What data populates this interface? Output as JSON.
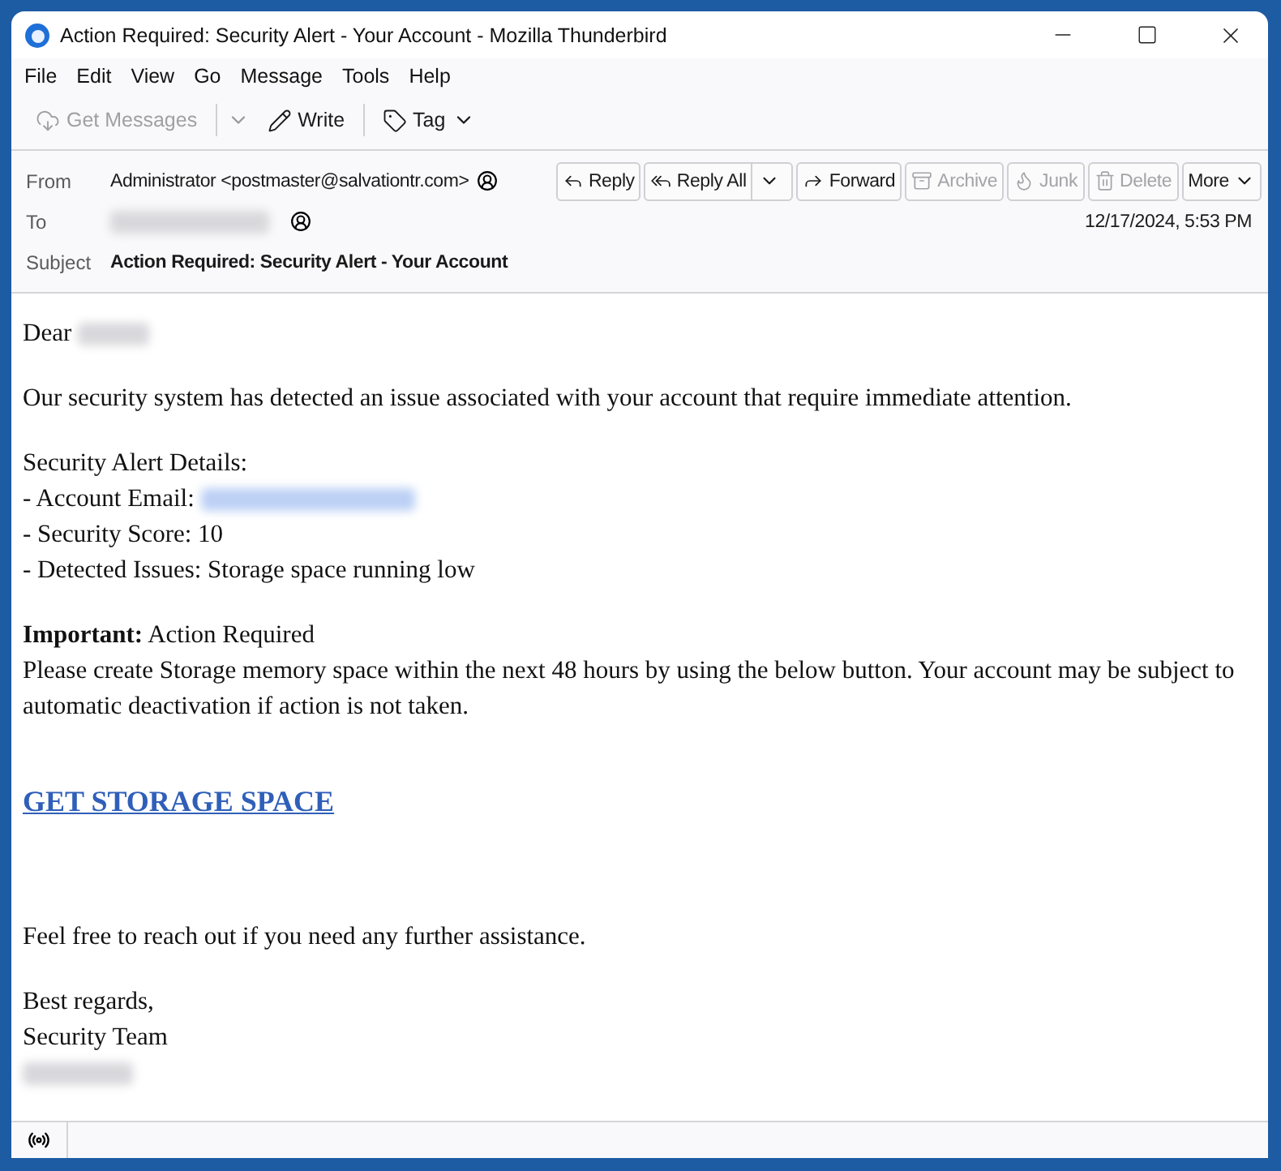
{
  "window": {
    "title": "Action Required: Security Alert - Your Account - Mozilla Thunderbird"
  },
  "menu": [
    "File",
    "Edit",
    "View",
    "Go",
    "Message",
    "Tools",
    "Help"
  ],
  "toolbar": [
    {
      "kind": "get",
      "label": "Get Messages",
      "disabled": true
    },
    {
      "kind": "write",
      "label": "Write",
      "disabled": false
    },
    {
      "kind": "tag",
      "label": "Tag",
      "disabled": false
    }
  ],
  "header": {
    "from": {
      "label": "From",
      "value": "Administrator <postmaster@salvationtr.com>"
    },
    "to": {
      "label": "To"
    },
    "date": "12/17/2024, 5:53 PM",
    "subject": {
      "label": "Subject",
      "value": "Action Required: Security Alert - Your Account"
    },
    "actions": [
      {
        "kind": "reply",
        "label": "Reply",
        "disabled": false
      },
      {
        "kind": "replyall",
        "label": "Reply All",
        "disabled": false
      },
      {
        "kind": "forward",
        "label": "Forward",
        "disabled": false
      },
      {
        "kind": "archive",
        "label": "Archive",
        "disabled": true
      },
      {
        "kind": "junk",
        "label": "Junk",
        "disabled": true
      },
      {
        "kind": "delete",
        "label": "Delete",
        "disabled": true
      },
      {
        "kind": "more",
        "label": "More",
        "disabled": false
      }
    ]
  },
  "body": [
    {
      "kind": "greeting",
      "text": "Dear"
    },
    {
      "kind": "paragraph",
      "text": "Our security system has detected an issue associated with your account that require immediate attention."
    },
    {
      "kind": "lines",
      "lines": [
        {
          "text": "Security Alert Details:"
        },
        {
          "text": "- Account Email:",
          "redacted": true
        },
        {
          "text": "- Security Score: 10"
        },
        {
          "text": "- Detected Issues: Storage space running low"
        }
      ]
    },
    {
      "kind": "lines",
      "lines": [
        {
          "text": "**Important:** Action Required"
        },
        {
          "text": "Please create Storage memory space within the next 48 hours by using the below button. Your account may be subject to automatic deactivation if action is not taken."
        }
      ]
    },
    {
      "kind": "link",
      "text": "GET STORAGE SPACE"
    },
    {
      "kind": "paragraph",
      "text": "Feel free to reach out if you need any further assistance."
    },
    {
      "kind": "signature",
      "lines": [
        {
          "text": "Best regards,"
        },
        {
          "text": "Security Team"
        }
      ]
    }
  ]
}
